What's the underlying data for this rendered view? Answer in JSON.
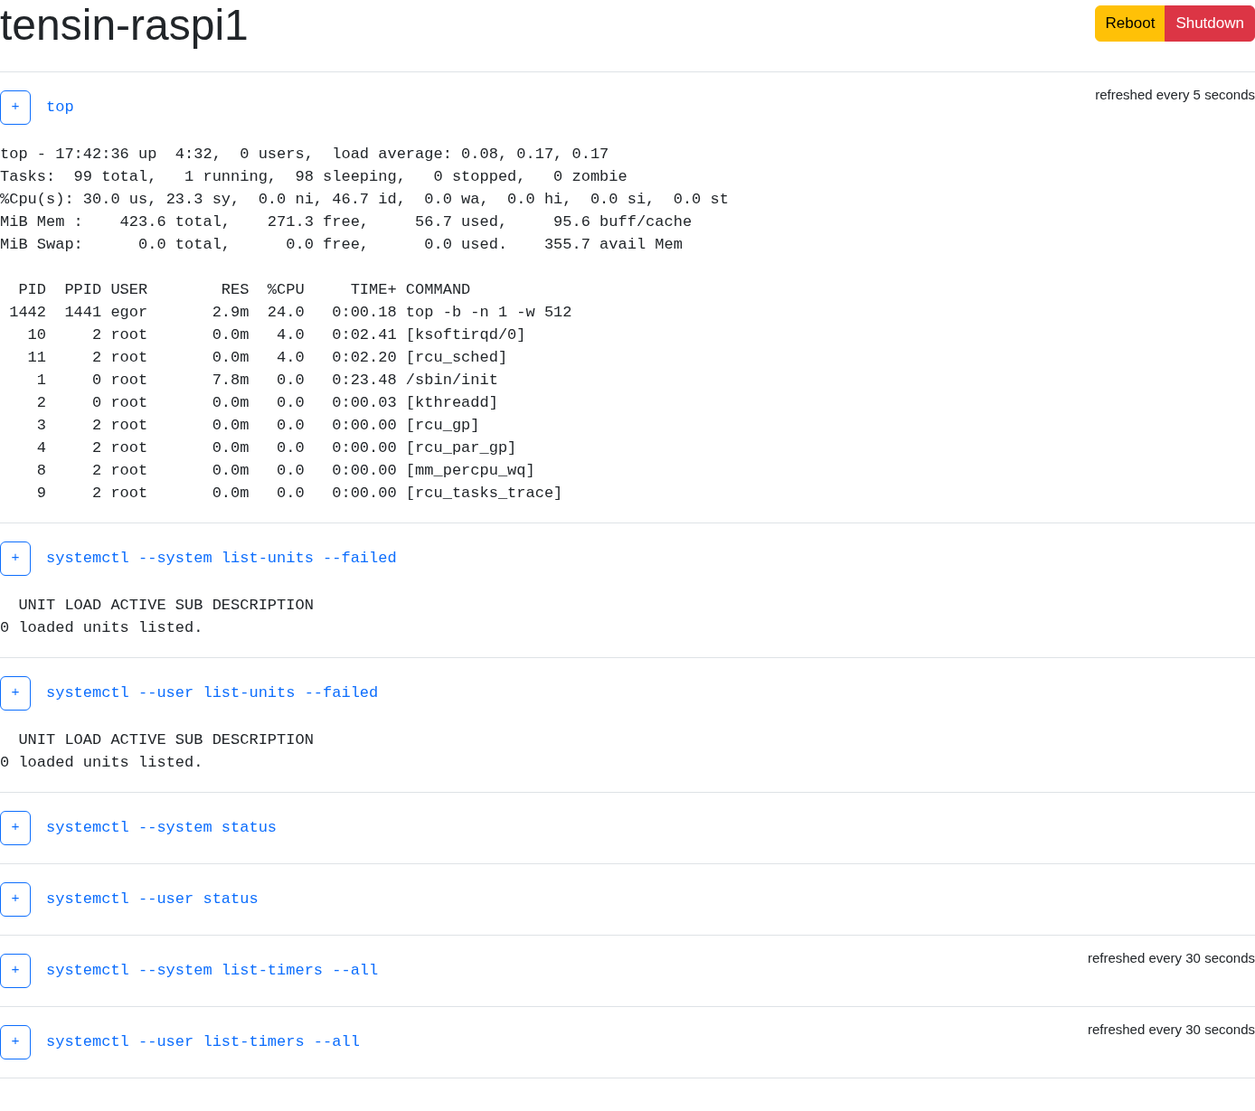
{
  "host": {
    "title": "tensin-raspi1"
  },
  "actions": [
    {
      "label": "Reboot",
      "kind": "warning"
    },
    {
      "label": "Shutdown",
      "kind": "danger"
    }
  ],
  "sections": [
    {
      "toggle": "+",
      "command": "top",
      "refresh": "refreshed every 5 seconds",
      "output": [
        [
          "top - 17:42:36 up  4:32,  0 users,  load average: 0.08, 0.17, 0.17",
          "Tasks:  99 total,   1 running,  98 sleeping,   0 stopped,   0 zombie",
          "%Cpu(s): 30.0 us, 23.3 sy,  0.0 ni, 46.7 id,  0.0 wa,  0.0 hi,  0.0 si,  0.0 st",
          "MiB Mem :    423.6 total,    271.3 free,     56.7 used,     95.6 buff/cache",
          "MiB Swap:      0.0 total,      0.0 free,      0.0 used.    355.7 avail Mem"
        ],
        [
          "  PID  PPID USER        RES  %CPU     TIME+ COMMAND",
          " 1442  1441 egor       2.9m  24.0   0:00.18 top -b -n 1 -w 512",
          "   10     2 root       0.0m   4.0   0:02.41 [ksoftirqd/0]",
          "   11     2 root       0.0m   4.0   0:02.20 [rcu_sched]",
          "    1     0 root       7.8m   0.0   0:23.48 /sbin/init",
          "    2     0 root       0.0m   0.0   0:00.03 [kthreadd]",
          "    3     2 root       0.0m   0.0   0:00.00 [rcu_gp]",
          "    4     2 root       0.0m   0.0   0:00.00 [rcu_par_gp]",
          "    8     2 root       0.0m   0.0   0:00.00 [mm_percpu_wq]",
          "    9     2 root       0.0m   0.0   0:00.00 [rcu_tasks_trace]"
        ]
      ]
    },
    {
      "toggle": "+",
      "command": "systemctl --system list-units --failed",
      "output": [
        [
          "  UNIT LOAD ACTIVE SUB DESCRIPTION",
          "0 loaded units listed."
        ]
      ]
    },
    {
      "toggle": "+",
      "command": "systemctl --user list-units --failed",
      "output": [
        [
          "  UNIT LOAD ACTIVE SUB DESCRIPTION",
          "0 loaded units listed."
        ]
      ]
    },
    {
      "toggle": "+",
      "command": "systemctl --system status"
    },
    {
      "toggle": "+",
      "command": "systemctl --user status"
    },
    {
      "toggle": "+",
      "command": "systemctl --system list-timers --all",
      "refresh": "refreshed every 30 seconds"
    },
    {
      "toggle": "+",
      "command": "systemctl --user list-timers --all",
      "refresh": "refreshed every 30 seconds"
    }
  ]
}
